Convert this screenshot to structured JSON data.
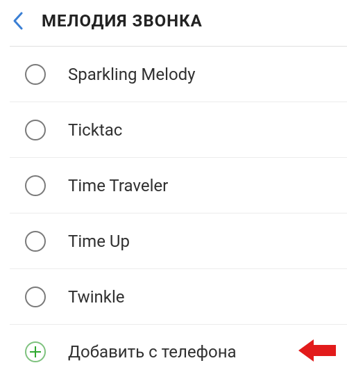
{
  "header": {
    "title": "МЕЛОДИЯ ЗВОНКА"
  },
  "ringtones": [
    {
      "label": "Sparkling Melody"
    },
    {
      "label": "Ticktac"
    },
    {
      "label": "Time Traveler"
    },
    {
      "label": "Time Up"
    },
    {
      "label": "Twinkle"
    }
  ],
  "add_action": {
    "label": "Добавить с телефона"
  }
}
